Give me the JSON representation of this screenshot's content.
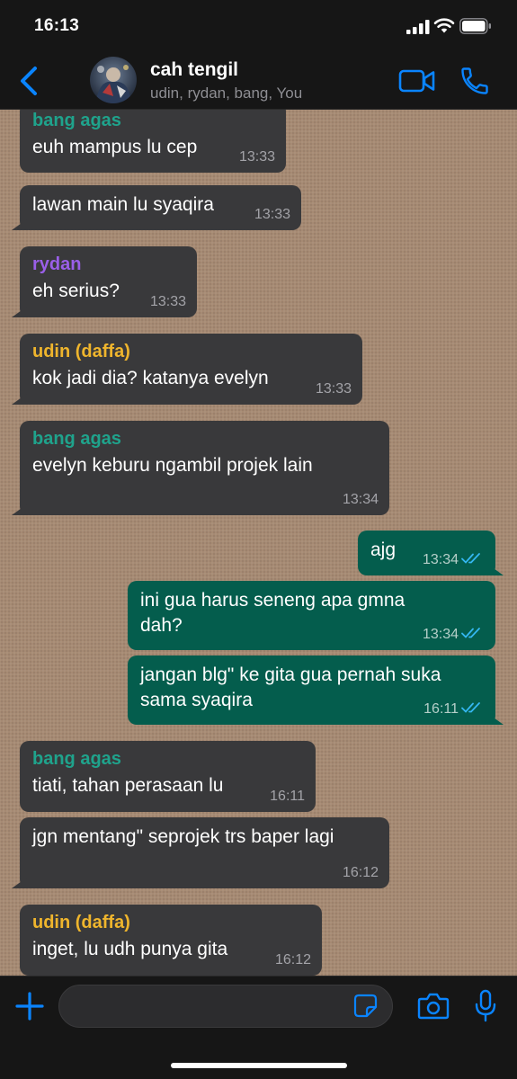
{
  "status_bar": {
    "time": "16:13",
    "icons": [
      "cellular-signal-icon",
      "wifi-icon",
      "battery-icon"
    ]
  },
  "header": {
    "title": "cah tengil",
    "subtitle": "udin, rydan, bang, You",
    "icons": [
      "back-chevron-icon",
      "group-avatar",
      "video-call-icon",
      "voice-call-icon"
    ],
    "accent_color": "#0a84ff"
  },
  "colors": {
    "incoming_bubble": "#39393b",
    "outgoing_bubble": "#045d4d",
    "read_ticks": "#34b7f1",
    "chat_background": "#a68a73"
  },
  "messages": [
    {
      "direction": "in",
      "sender": "bang agas",
      "sender_color": "#1fa38c",
      "text": "euh mampus lu cep",
      "time": "13:33"
    },
    {
      "direction": "in",
      "sender": "",
      "text": "lawan main lu syaqira",
      "time": "13:33"
    },
    {
      "direction": "in",
      "sender": "rydan",
      "sender_color": "#9a5fe8",
      "text": "eh serius?",
      "time": "13:33"
    },
    {
      "direction": "in",
      "sender": "udin (daffa)",
      "sender_color": "#efb52d",
      "text": "kok jadi dia? katanya evelyn",
      "time": "13:33"
    },
    {
      "direction": "in",
      "sender": "bang agas",
      "sender_color": "#1fa38c",
      "text": "evelyn keburu ngambil projek lain",
      "time": "13:34"
    },
    {
      "direction": "out",
      "text": "ajg",
      "time": "13:34",
      "status": "read"
    },
    {
      "direction": "out",
      "text_lines": [
        "ini gua harus seneng apa gmna",
        "dah?"
      ],
      "time": "13:34",
      "status": "read"
    },
    {
      "direction": "out",
      "text_lines": [
        "jangan blg\" ke gita gua pernah suka",
        "sama syaqira"
      ],
      "time": "16:11",
      "status": "read"
    },
    {
      "direction": "in",
      "sender": "bang agas",
      "sender_color": "#1fa38c",
      "text": "tiati, tahan perasaan lu",
      "time": "16:11"
    },
    {
      "direction": "in",
      "sender": "",
      "text": "jgn mentang\" seprojek trs baper lagi",
      "time": "16:12"
    },
    {
      "direction": "in",
      "sender": "udin (daffa)",
      "sender_color": "#efb52d",
      "text": "inget, lu udh punya gita",
      "time": "16:12"
    }
  ],
  "input_bar": {
    "placeholder": "",
    "value": "",
    "icons": [
      "plus-icon",
      "sticker-icon",
      "camera-icon",
      "microphone-icon"
    ]
  }
}
